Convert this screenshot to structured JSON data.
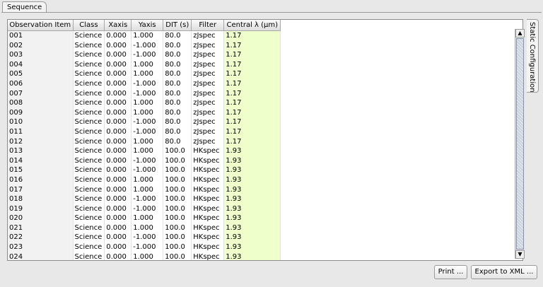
{
  "tabs": [
    {
      "label": "Sequence"
    }
  ],
  "side_tab": {
    "label": "Static Configuration"
  },
  "columns": [
    "Observation Item",
    "Class",
    "Xaxis",
    "Yaxis",
    "DIT (s)",
    "Filter",
    "Central λ (μm)"
  ],
  "rows": [
    [
      "001",
      "Science",
      "0.000",
      "1.000",
      "80.0",
      "zJspec",
      "1.17"
    ],
    [
      "002",
      "Science",
      "0.000",
      "-1.000",
      "80.0",
      "zJspec",
      "1.17"
    ],
    [
      "003",
      "Science",
      "0.000",
      "-1.000",
      "80.0",
      "zJspec",
      "1.17"
    ],
    [
      "004",
      "Science",
      "0.000",
      "1.000",
      "80.0",
      "zJspec",
      "1.17"
    ],
    [
      "005",
      "Science",
      "0.000",
      "1.000",
      "80.0",
      "zJspec",
      "1.17"
    ],
    [
      "006",
      "Science",
      "0.000",
      "-1.000",
      "80.0",
      "zJspec",
      "1.17"
    ],
    [
      "007",
      "Science",
      "0.000",
      "-1.000",
      "80.0",
      "zJspec",
      "1.17"
    ],
    [
      "008",
      "Science",
      "0.000",
      "1.000",
      "80.0",
      "zJspec",
      "1.17"
    ],
    [
      "009",
      "Science",
      "0.000",
      "1.000",
      "80.0",
      "zJspec",
      "1.17"
    ],
    [
      "010",
      "Science",
      "0.000",
      "-1.000",
      "80.0",
      "zJspec",
      "1.17"
    ],
    [
      "011",
      "Science",
      "0.000",
      "-1.000",
      "80.0",
      "zJspec",
      "1.17"
    ],
    [
      "012",
      "Science",
      "0.000",
      "1.000",
      "80.0",
      "zJspec",
      "1.17"
    ],
    [
      "013",
      "Science",
      "0.000",
      "1.000",
      "100.0",
      "HKspec",
      "1.93"
    ],
    [
      "014",
      "Science",
      "0.000",
      "-1.000",
      "100.0",
      "HKspec",
      "1.93"
    ],
    [
      "015",
      "Science",
      "0.000",
      "-1.000",
      "100.0",
      "HKspec",
      "1.93"
    ],
    [
      "016",
      "Science",
      "0.000",
      "1.000",
      "100.0",
      "HKspec",
      "1.93"
    ],
    [
      "017",
      "Science",
      "0.000",
      "1.000",
      "100.0",
      "HKspec",
      "1.93"
    ],
    [
      "018",
      "Science",
      "0.000",
      "-1.000",
      "100.0",
      "HKspec",
      "1.93"
    ],
    [
      "019",
      "Science",
      "0.000",
      "-1.000",
      "100.0",
      "HKspec",
      "1.93"
    ],
    [
      "020",
      "Science",
      "0.000",
      "1.000",
      "100.0",
      "HKspec",
      "1.93"
    ],
    [
      "021",
      "Science",
      "0.000",
      "1.000",
      "100.0",
      "HKspec",
      "1.93"
    ],
    [
      "022",
      "Science",
      "0.000",
      "-1.000",
      "100.0",
      "HKspec",
      "1.93"
    ],
    [
      "023",
      "Science",
      "0.000",
      "-1.000",
      "100.0",
      "HKspec",
      "1.93"
    ],
    [
      "024",
      "Science",
      "0.000",
      "1.000",
      "100.0",
      "HKspec",
      "1.93"
    ]
  ],
  "scrollbar": {
    "up_icon": "arrow-up-icon",
    "down_icon": "arrow-down-icon"
  },
  "buttons": {
    "print": "Print ...",
    "export": "Export to XML ..."
  },
  "colors": {
    "highlight_column": "#eeffcc",
    "first_column": "#f2f2f2"
  }
}
